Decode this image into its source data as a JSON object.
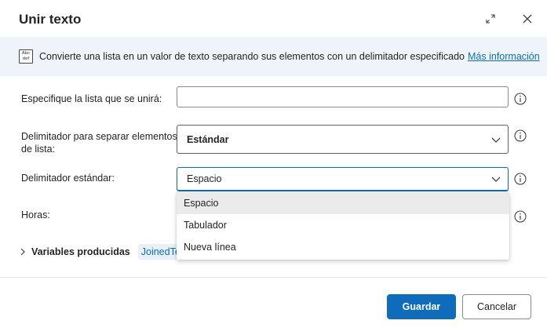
{
  "dialog": {
    "title": "Unir texto"
  },
  "banner": {
    "icon_text": "Abc def",
    "text": "Convierte una lista en un valor de texto separando sus elementos con un delimitador especificado",
    "link": "Más información"
  },
  "fields": {
    "list_label": "Especifique la lista que se unirá:",
    "list_value": "",
    "delimiter_label": "Delimitador para separar elementos de lista:",
    "delimiter_value": "Estándar",
    "standard_label": "Delimitador estándar:",
    "standard_value": "Espacio",
    "hours_label": "Horas:"
  },
  "dropdown": {
    "options": [
      "Espacio",
      "Tabulador",
      "Nueva línea"
    ],
    "selected_index": 0
  },
  "variables": {
    "label": "Variables producidas",
    "chip": "JoinedText"
  },
  "footer": {
    "save_label": "Guardar",
    "cancel_label": "Cancelar"
  },
  "colors": {
    "accent": "#0f6cbd",
    "banner_bg": "#eff4fb"
  }
}
